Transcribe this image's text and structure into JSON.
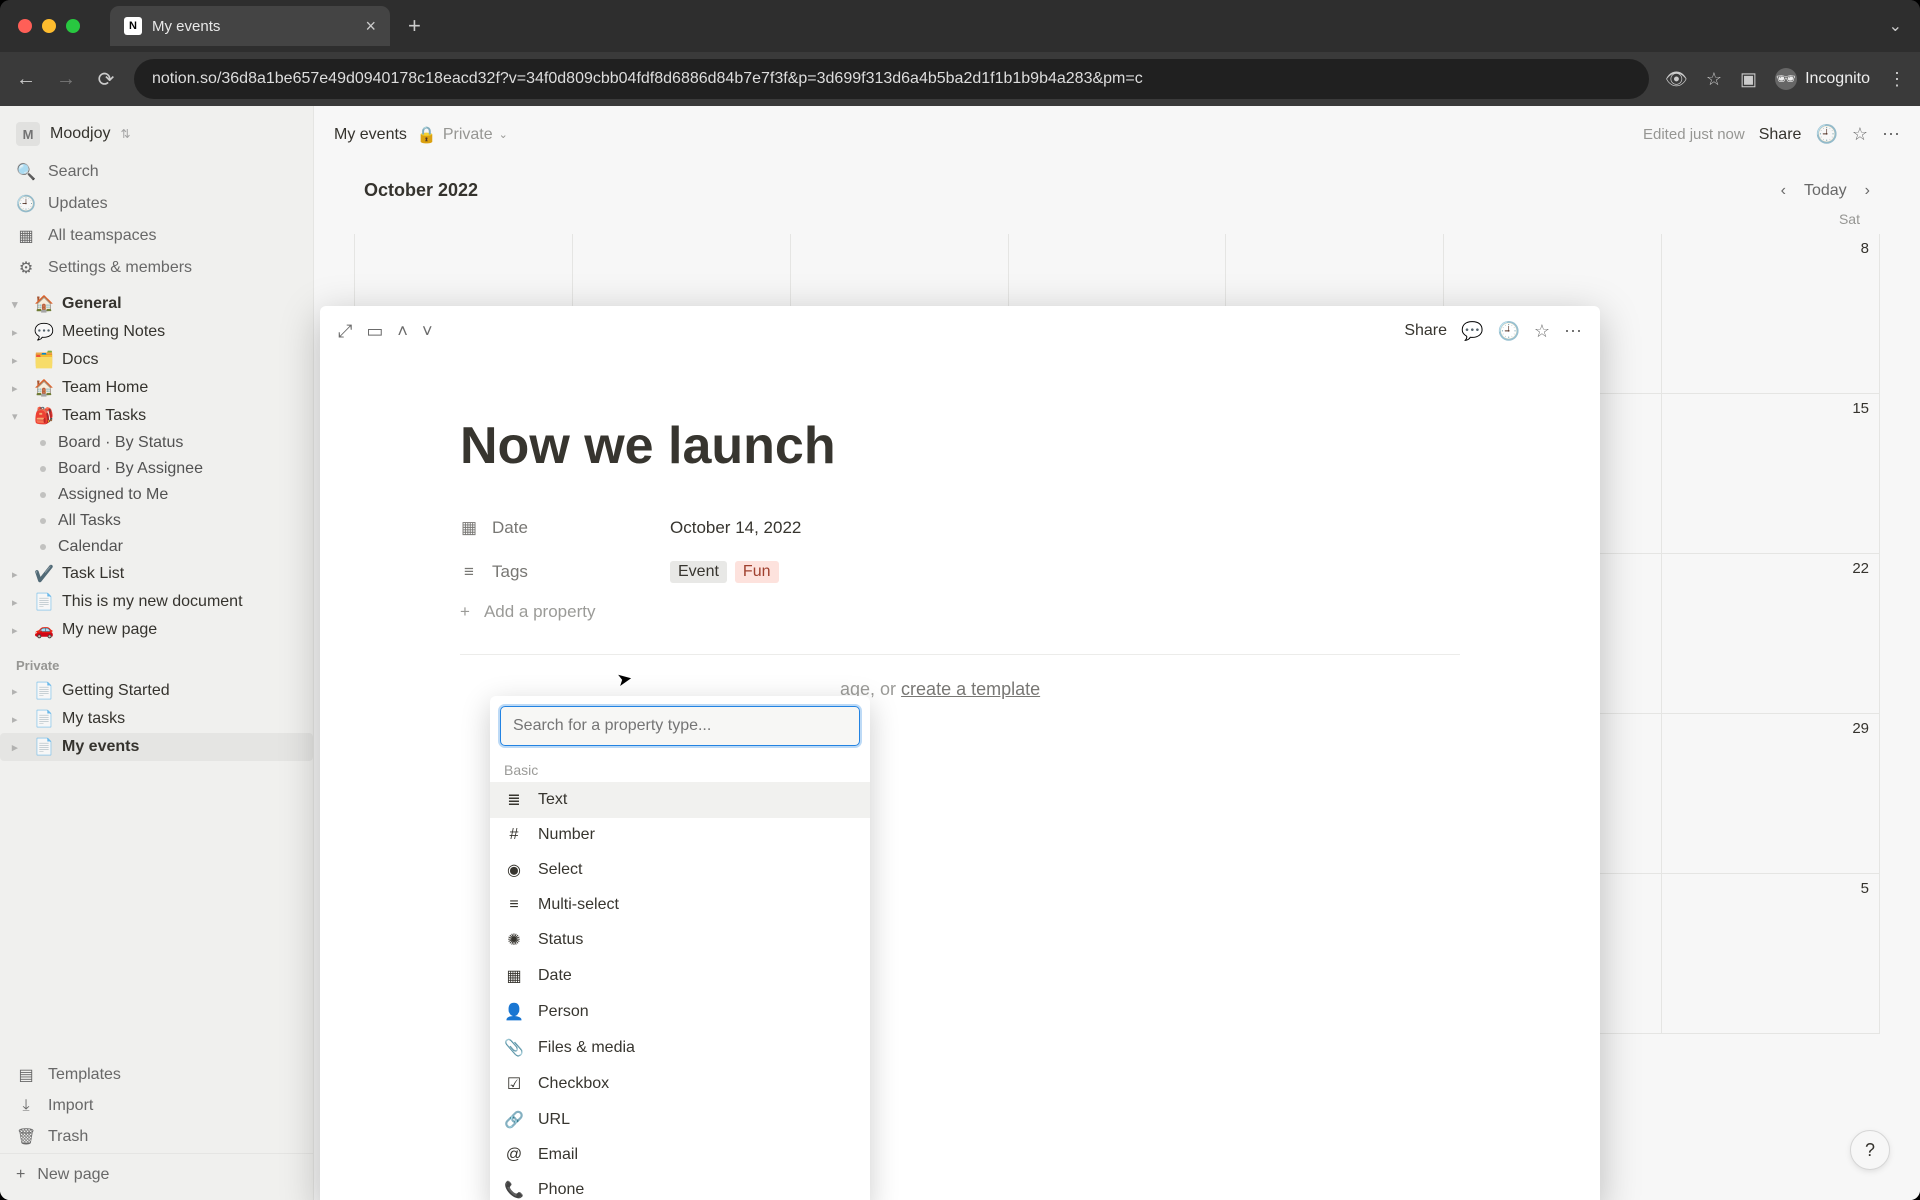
{
  "browser": {
    "tab_title": "My events",
    "url": "notion.so/36d8a1be657e49d0940178c18eacd32f?v=34f0d809cbb04fdf8d6886d84b7e7f3f&p=3d699f313d6a4b5ba2d1f1b1b9b4a283&pm=c",
    "incognito_label": "Incognito"
  },
  "workspace": {
    "initial": "M",
    "name": "Moodjoy"
  },
  "sidebar": {
    "search": "Search",
    "updates": "Updates",
    "teamspaces": "All teamspaces",
    "settings": "Settings & members",
    "general_label": "General",
    "items": [
      {
        "emoji": "💬",
        "label": "Meeting Notes"
      },
      {
        "emoji": "🗂️",
        "label": "Docs"
      },
      {
        "emoji": "🏠",
        "label": "Team Home"
      },
      {
        "emoji": "🎒",
        "label": "Team Tasks"
      }
    ],
    "team_tasks_children": [
      "Board · By Status",
      "Board · By Assignee",
      "Assigned to Me",
      "All Tasks",
      "Calendar"
    ],
    "more_items": [
      {
        "emoji": "✔️",
        "label": "Task List"
      },
      {
        "emoji": "📄",
        "label": "This is my new document"
      },
      {
        "emoji": "🚗",
        "label": "My new page"
      }
    ],
    "private_label": "Private",
    "private_items": [
      {
        "emoji": "📄",
        "label": "Getting Started"
      },
      {
        "emoji": "📄",
        "label": "My tasks"
      },
      {
        "emoji": "📄",
        "label": "My events"
      }
    ],
    "templates": "Templates",
    "import": "Import",
    "trash": "Trash",
    "new_page": "New page"
  },
  "topbar": {
    "crumb": "My events",
    "private": "Private",
    "edited": "Edited just now",
    "share": "Share"
  },
  "calendar": {
    "month": "October 2022",
    "today": "Today",
    "sat": "Sat",
    "dates_col": [
      "8",
      "15",
      "22",
      "29",
      "5"
    ]
  },
  "page": {
    "share": "Share",
    "title": "Now we launch",
    "props": {
      "date_label": "Date",
      "date_value": "October 14, 2022",
      "tags_label": "Tags",
      "tags": [
        "Event",
        "Fun"
      ]
    },
    "add_property": "Add a property",
    "hint_suffix": "age, or ",
    "hint_link": "create a template"
  },
  "dropdown": {
    "placeholder": "Search for a property type...",
    "group": "Basic",
    "options": [
      {
        "icon": "≣",
        "label": "Text"
      },
      {
        "icon": "#",
        "label": "Number"
      },
      {
        "icon": "◉",
        "label": "Select"
      },
      {
        "icon": "≡",
        "label": "Multi-select"
      },
      {
        "icon": "✺",
        "label": "Status"
      },
      {
        "icon": "▦",
        "label": "Date"
      },
      {
        "icon": "👤",
        "label": "Person"
      },
      {
        "icon": "📎",
        "label": "Files & media"
      },
      {
        "icon": "☑",
        "label": "Checkbox"
      },
      {
        "icon": "🔗",
        "label": "URL"
      },
      {
        "icon": "@",
        "label": "Email"
      },
      {
        "icon": "📞",
        "label": "Phone"
      }
    ]
  }
}
